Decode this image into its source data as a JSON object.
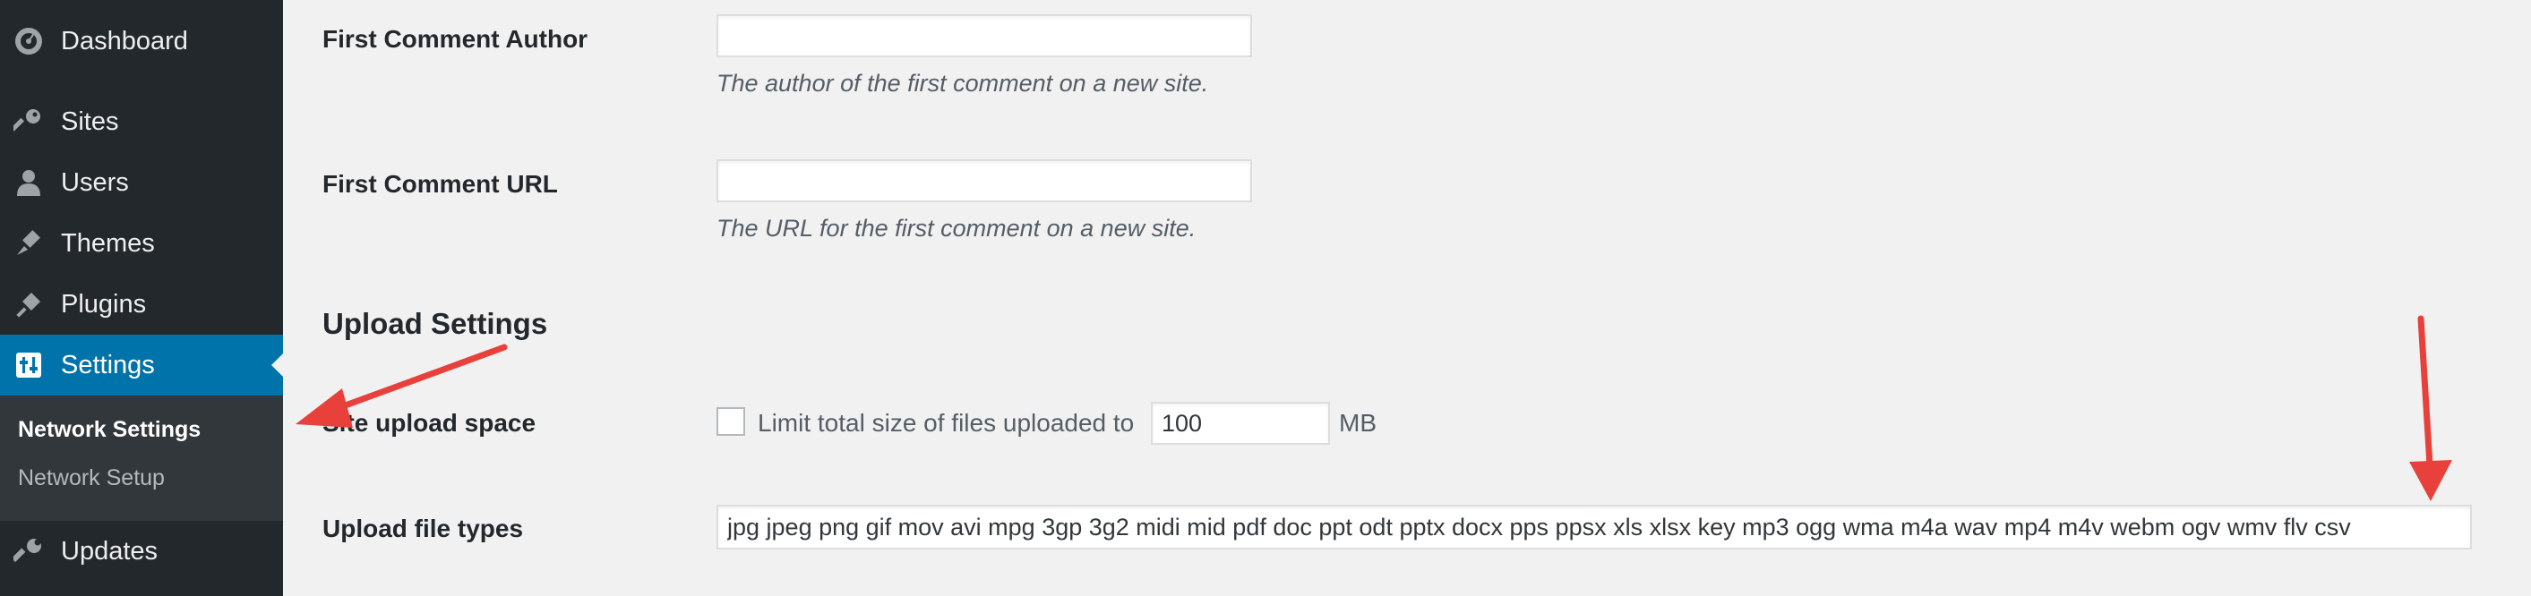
{
  "sidebar": {
    "items": [
      {
        "label": "Dashboard",
        "icon": "dashboard-icon"
      },
      {
        "label": "Sites",
        "icon": "key-icon"
      },
      {
        "label": "Users",
        "icon": "user-icon"
      },
      {
        "label": "Themes",
        "icon": "brush-icon"
      },
      {
        "label": "Plugins",
        "icon": "plug-icon"
      },
      {
        "label": "Settings",
        "icon": "settings-sliders-icon",
        "current": true
      },
      {
        "label": "Updates",
        "icon": "wrench-icon"
      }
    ],
    "submenu": [
      {
        "label": "Network Settings",
        "active": true
      },
      {
        "label": "Network Setup"
      }
    ],
    "accent_color": "#0073aa",
    "background_color": "#23282d"
  },
  "form": {
    "first_comment_author": {
      "label": "First Comment Author",
      "value": "",
      "description": "The author of the first comment on a new site."
    },
    "first_comment_url": {
      "label": "First Comment URL",
      "value": "",
      "description": "The URL for the first comment on a new site."
    },
    "upload_settings_title": "Upload Settings",
    "site_upload_space": {
      "label": "Site upload space",
      "checkbox_checked": false,
      "checkbox_label": "Limit total size of files uploaded to",
      "value": "100",
      "unit": "MB"
    },
    "upload_file_types": {
      "label": "Upload file types",
      "value": "jpg jpeg png gif mov avi mpg 3gp 3g2 midi mid pdf doc ppt odt pptx docx pps ppsx xls xlsx key mp3 ogg wma m4a wav mp4 m4v webm ogv wmv flv csv"
    }
  },
  "annotations": {
    "arrow_color": "#e8403a"
  }
}
